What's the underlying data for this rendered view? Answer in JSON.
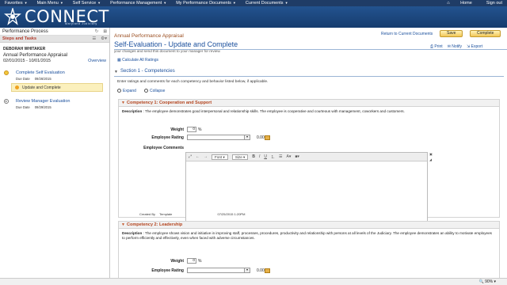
{
  "topbar": {
    "menus": [
      {
        "label": "Favorites"
      },
      {
        "label": "Main Menu"
      },
      {
        "label": "Self Service"
      },
      {
        "label": "Performance Management"
      },
      {
        "label": "My Performance Documents"
      },
      {
        "label": "Current Documents"
      }
    ],
    "home": "Home",
    "signout": "Sign out"
  },
  "header": {
    "logo_text": "CONNECT",
    "logo_sub": "Maryland Judiciary"
  },
  "left": {
    "panel_title": "Performance Process",
    "steps_title": "Steps and Tasks",
    "employee_name": "DEBORAH WHITAKER",
    "doc_type": "Annual Performance Appraisal",
    "period": "02/01/2015  -  10/01/2015",
    "overview": "Overview",
    "steps": [
      {
        "title": "Complete Self Evaluation",
        "due_label": "Due Date",
        "due": "09/26/2015",
        "substep": "Update and Complete"
      },
      {
        "title": "Review Manager Evaluation",
        "due_label": "Due Date",
        "due": "09/29/2015"
      }
    ]
  },
  "main": {
    "form_type": "Annual Performance Appraisal",
    "page_title": "Self-Evaluation - Update and Complete",
    "return_link": "Return to Current Documents",
    "save": "Save",
    "complete": "Complete",
    "print": "Print",
    "notify": "Notify",
    "export": "Export",
    "cut_text": "your changes and send this document to your manager for review.",
    "calc_all": "Calculate All Ratings",
    "section_title": "Section 1 - Competencies",
    "instructions": "Enter ratings and comments for each competency and behavior listed below, if applicable.",
    "expand": "Expand",
    "collapse": "Collapse"
  },
  "comp1": {
    "title": "Competency 1: Cooperation and Support",
    "desc_label": "Description",
    "desc": " : The employee demonstrates good interpersonal and relationship skills. The employee is cooperative and courteous with management, coworkers and customers.",
    "weight_label": "Weight",
    "weight": "0",
    "pct": "%",
    "rating_label": "Employee Rating",
    "rating_value": "0.00",
    "comments_label": "Employee Comments",
    "created_by_label": "Created By",
    "created_by": "Template",
    "created_at": "07/25/2015  1:20PM"
  },
  "editor": {
    "font": "Font",
    "size": "Size",
    "bold": "B",
    "italic": "I",
    "underline": "U"
  },
  "comp2": {
    "title": "Competency 2: Leadership",
    "desc_label": "Description",
    "desc": " : The employee shows vision and initiative in improving staff, processes, procedures, productivity and relationship with persons at all levels of the Judiciary. The employee demonstrates an ability to motivate employees to perform efficiently and effectively, even when faced with adverse circumstances.",
    "weight_label": "Weight",
    "weight": "0",
    "pct": "%",
    "rating_label": "Employee Rating",
    "rating_value": "0.00"
  },
  "status": {
    "zoom": "90%"
  },
  "colors": {
    "nav_bg": "#1f3c66",
    "header_bg": "#23538f",
    "link": "#1a4f9c",
    "comp_title": "#b4451f",
    "button": "#f1c757"
  }
}
